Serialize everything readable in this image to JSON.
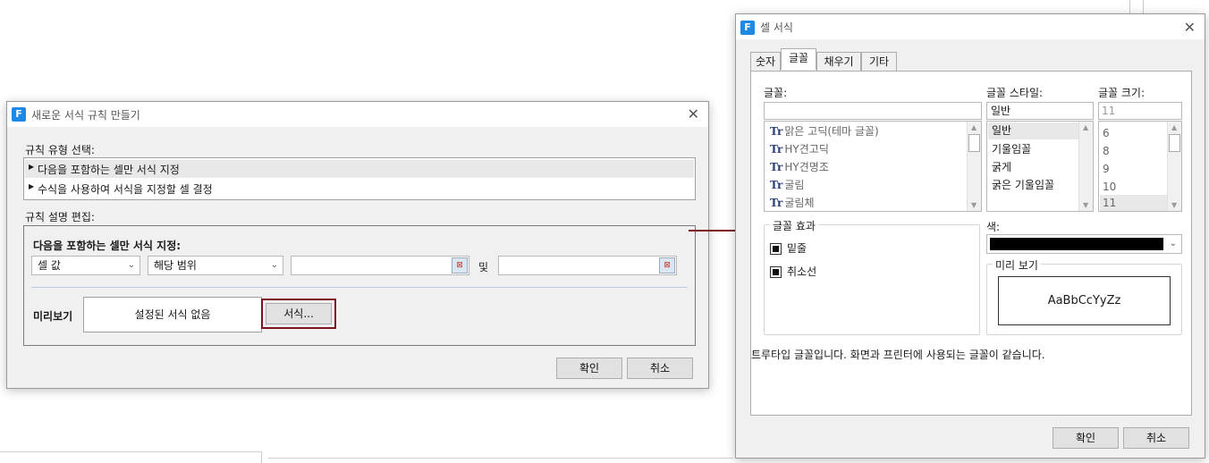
{
  "rule_dialog": {
    "title": "새로운 서식 규칙 만들기",
    "rule_type_label": "규칙 유형 선택:",
    "rule_types": [
      "다음을 포함하는 셀만 서식 지정",
      "수식을 사용하여 서식을 지정할 셀 결정"
    ],
    "edit_label": "규칙 설명 편집:",
    "condition_heading": "다음을 포함하는 셀만 서식 지정:",
    "condition_type": "셀 값",
    "operator": "해당 범위",
    "and_label": "및",
    "preview_label": "미리보기",
    "preview_text": "설정된 서식 없음",
    "format_button": "서식...",
    "ok": "확인",
    "cancel": "취소"
  },
  "cell_format_dialog": {
    "title": "셀 서식",
    "tabs": [
      "숫자",
      "글꼴",
      "채우기",
      "기타"
    ],
    "active_tab": "글꼴",
    "font_label": "글꼴:",
    "font_input": "",
    "fonts": [
      "맑은 고딕(테마 글꼴)",
      "HY견고딕",
      "HY견명조",
      "굴림",
      "굴림체"
    ],
    "style_label": "글꼴 스타일:",
    "style_input": "일반",
    "styles": [
      "일반",
      "기울임꼴",
      "굵게",
      "굵은 기울임꼴"
    ],
    "size_label": "글꼴 크기:",
    "size_input": "11",
    "sizes": [
      "6",
      "8",
      "9",
      "10",
      "11"
    ],
    "effects_label": "글꼴 효과",
    "effects": [
      "밑줄",
      "취소선"
    ],
    "color_label": "색:",
    "color_value": "#000000",
    "preview_label": "미리 보기",
    "preview_sample": "AaBbCcYyZz",
    "info_text": "트루타입 글꼴입니다. 화면과 프린터에 사용되는 글꼴이 같습니다.",
    "ok": "확인",
    "cancel": "취소"
  },
  "icons": {
    "app": "F",
    "close": "✕",
    "expand": "▶",
    "dropdown": "⌄",
    "font_type": "Tr"
  },
  "colors": {
    "highlight": "#7b1520",
    "accent": "#1e88e5"
  }
}
